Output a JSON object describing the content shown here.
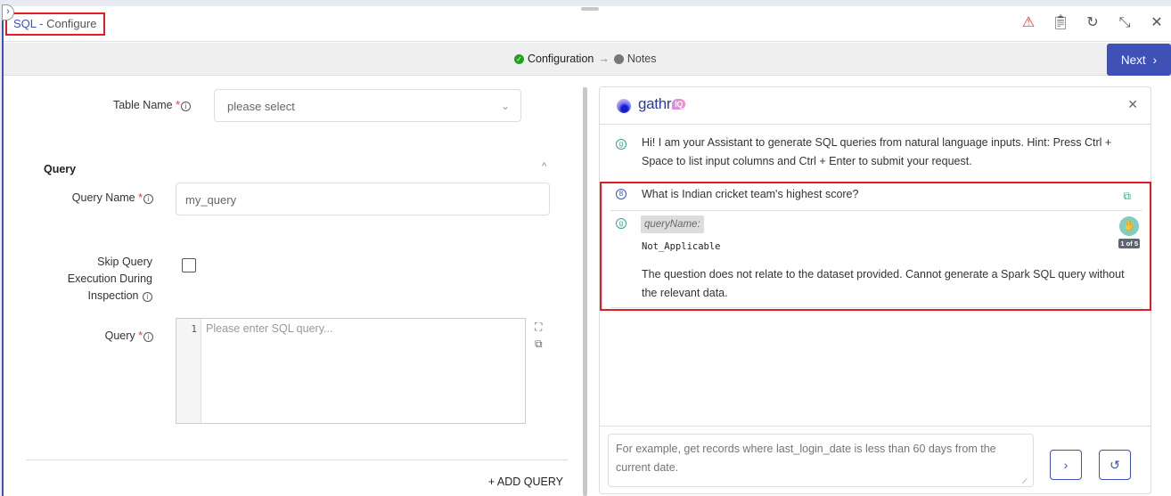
{
  "window": {
    "title_prefix": "SQL",
    "title_suffix": " - Configure",
    "icons": [
      "warning-icon",
      "clipboard-icon",
      "reset-icon",
      "collapse-icon",
      "close-icon"
    ]
  },
  "stepper": {
    "steps": [
      {
        "label": "Configuration",
        "status": "complete"
      },
      {
        "label": "Notes",
        "status": "pending"
      }
    ],
    "arrow": "→",
    "next_label": "Next"
  },
  "form": {
    "table_name": {
      "label": "Table Name ",
      "placeholder": "please select"
    },
    "section_title": "Query",
    "query_name": {
      "label": "Query Name ",
      "value": "my_query"
    },
    "skip_query": {
      "label_line1": "Skip Query",
      "label_line2": "Execution During",
      "label_line3": "Inspection ",
      "checked": false
    },
    "query": {
      "label": "Query ",
      "line_number": "1",
      "placeholder": "Please enter SQL query..."
    },
    "add_query_label": "ADD QUERY",
    "required_mark": "*"
  },
  "assistant": {
    "brand": "gathr",
    "brand_badge": "IQ",
    "messages": [
      {
        "role": "assistant",
        "text": "Hi! I am your Assistant to generate SQL queries from natural language inputs. Hint: Press Ctrl + Space to list input columns and Ctrl + Enter to submit your request."
      },
      {
        "role": "user",
        "text": "What is Indian cricket team's highest score?"
      },
      {
        "role": "assistant",
        "query_label": "queryName:",
        "query_value": "Not_Applicable",
        "text": "The question does not relate to the dataset provided. Cannot generate a Spark SQL query without the relevant data.",
        "pager": "1 of 5"
      }
    ],
    "input_placeholder": "For example, get records where last_login_date is less than 60 days from the current date."
  },
  "colors": {
    "accent": "#3f51b5",
    "highlight": "#e31b23",
    "success": "#1ea51e",
    "assistant_teal": "#35a58e"
  }
}
